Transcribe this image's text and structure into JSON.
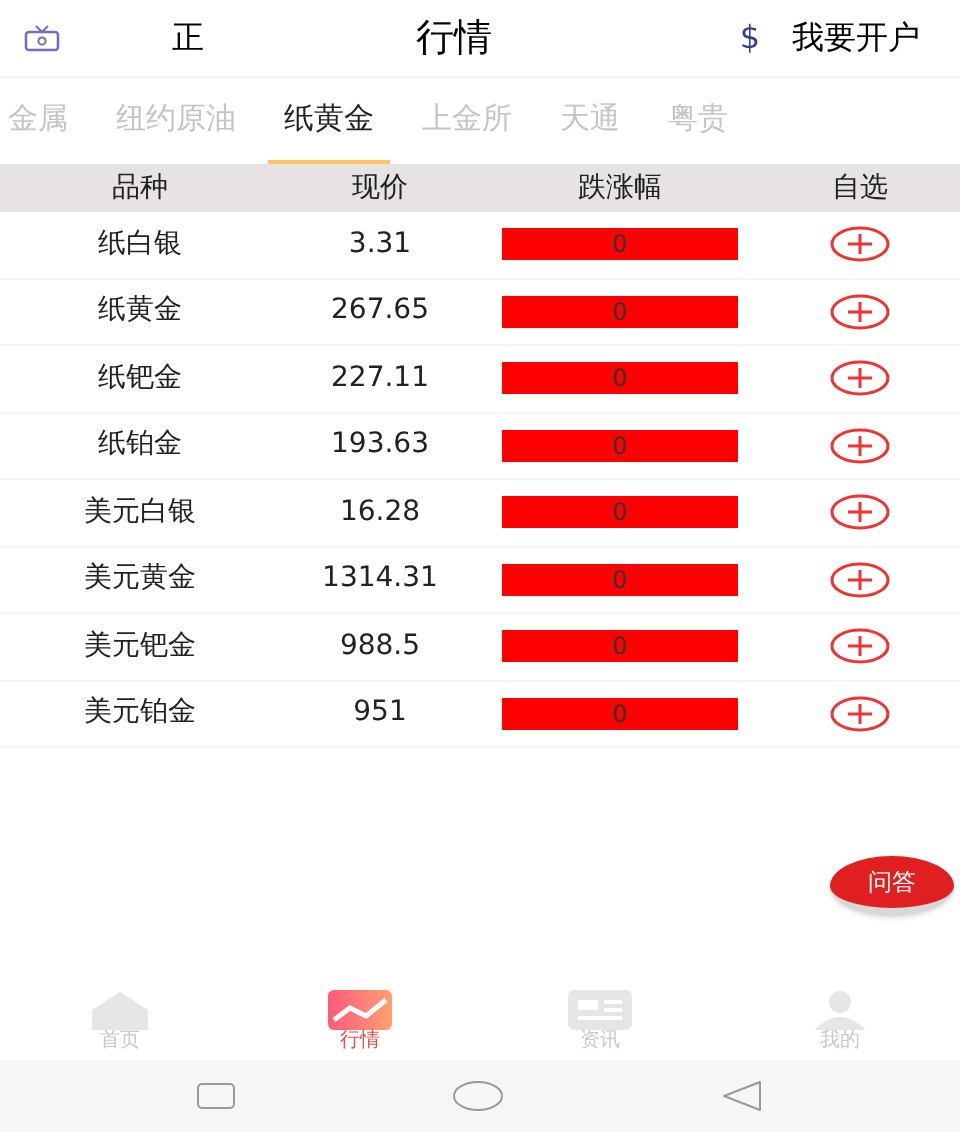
{
  "header": {
    "marquee": "正",
    "title": "行情",
    "account_icon": "$",
    "account_link": "我要开户"
  },
  "tabs": [
    {
      "label": "金属",
      "selected": false
    },
    {
      "label": "纽约原油",
      "selected": false
    },
    {
      "label": "纸黄金",
      "selected": true
    },
    {
      "label": "上金所",
      "selected": false
    },
    {
      "label": "天通",
      "selected": false
    },
    {
      "label": "粤贵",
      "selected": false
    }
  ],
  "table": {
    "columns": [
      "品种",
      "现价",
      "跌涨幅",
      "自选"
    ],
    "rows": [
      {
        "name": "纸白银",
        "price": "3.31",
        "change": "0"
      },
      {
        "name": "纸黄金",
        "price": "267.65",
        "change": "0"
      },
      {
        "name": "纸钯金",
        "price": "227.11",
        "change": "0"
      },
      {
        "name": "纸铂金",
        "price": "193.63",
        "change": "0"
      },
      {
        "name": "美元白银",
        "price": "16.28",
        "change": "0"
      },
      {
        "name": "美元黄金",
        "price": "1314.31",
        "change": "0"
      },
      {
        "name": "美元钯金",
        "price": "988.5",
        "change": "0"
      },
      {
        "name": "美元铂金",
        "price": "951",
        "change": "0"
      }
    ]
  },
  "float_button": "问答",
  "bottom_nav": [
    {
      "kind": "home",
      "label": "首页",
      "selected": false
    },
    {
      "kind": "chart",
      "label": "行情",
      "selected": true
    },
    {
      "kind": "news",
      "label": "资讯",
      "selected": false
    },
    {
      "kind": "user",
      "label": "我的",
      "selected": false
    }
  ]
}
